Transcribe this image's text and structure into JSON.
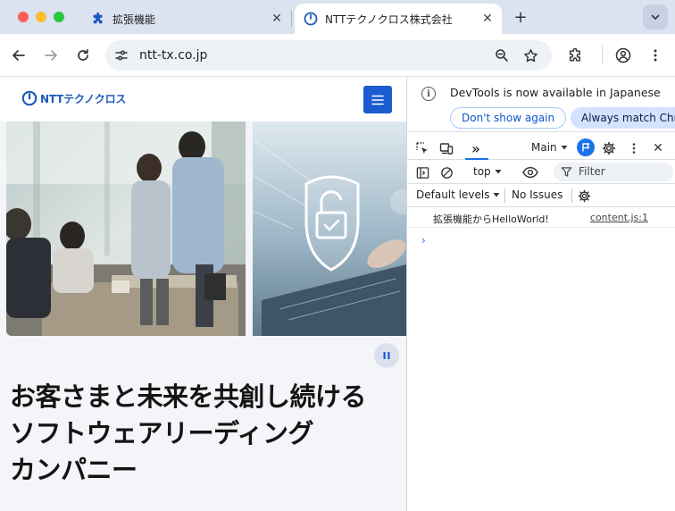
{
  "browser": {
    "tabs": [
      {
        "title": "拡張機能",
        "icon": "puzzle-icon",
        "active": false
      },
      {
        "title": "NTTテクノクロス株式会社",
        "icon": "ntt-favicon-icon",
        "active": true
      }
    ],
    "close_glyph": "✕",
    "new_tab_glyph": "+",
    "url": "ntt-tx.co.jp"
  },
  "page": {
    "logo_text": "NTTテクノクロス",
    "headline": [
      "お客さまと未来を共創し続ける",
      "ソフトウェアリーディング",
      "カンパニー"
    ],
    "hero_images": [
      "team-meeting-photo",
      "security-lock-photo"
    ]
  },
  "devtools": {
    "info_glyph": "i",
    "info_message": "DevTools is now available in Japanese",
    "dont_show_label": "Don't show again",
    "always_match_label": "Always match Chrome's language",
    "more_tabs_glyph": "»",
    "target": "Main",
    "context": "top",
    "filter_placeholder": "Filter",
    "levels_label": "Default levels",
    "issues_label": "No Issues",
    "close_glyph": "✕",
    "log": [
      {
        "message": "拡張機能からHelloWorld!",
        "source": "content.js:1"
      }
    ],
    "prompt_glyph": "›"
  },
  "colors": {
    "accent": "#1a73e8",
    "brand": "#1e5bb8",
    "hamburger_bg": "#1b5bd0"
  }
}
